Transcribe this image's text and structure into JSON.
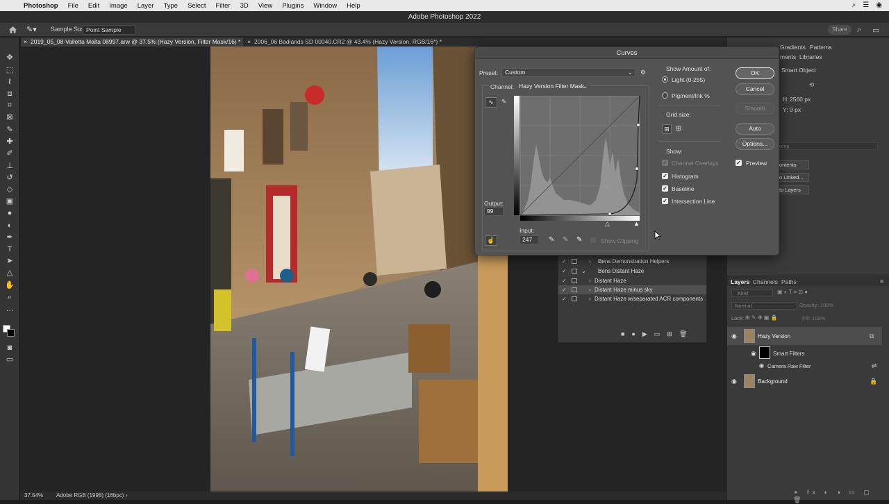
{
  "menubar": {
    "app": "Photoshop",
    "items": [
      "File",
      "Edit",
      "Image",
      "Layer",
      "Type",
      "Select",
      "Filter",
      "3D",
      "View",
      "Plugins",
      "Window",
      "Help"
    ]
  },
  "window_title": "Adobe Photoshop 2022",
  "options": {
    "sample_size_label": "Sample Size:",
    "sample_size_value": "Point Sample",
    "share_label": "Share"
  },
  "doc_tabs": [
    {
      "label": "2019_05_08-Valletta Malta 08997.arw @ 37.5% (Hazy Version, Filter Mask/16) *"
    },
    {
      "label": "2006_06 Badlands SD 00040.CR2 @ 43.4% (Hazy Version, RGB/16*) *"
    }
  ],
  "status": {
    "zoom": "37.54%",
    "profile": "Adobe RGB (1998) (16bpc)"
  },
  "right_panel": {
    "tabs_top": [
      "Gradients",
      "Patterns"
    ],
    "tabs_top2": [
      "ments",
      "Libraries"
    ],
    "smart_object": "Smart Object",
    "h_label": "H:",
    "h_value": "2560 px",
    "y_label": "Y:",
    "y_value": "0 px",
    "comp_placeholder": "omp",
    "buttons": [
      "ontents",
      "o Linked...",
      "to Layers"
    ]
  },
  "actions": {
    "rows": [
      {
        "name": "Bens Demonstration Helpers",
        "indent": 1
      },
      {
        "name": "Bens Distant Haze",
        "indent": 1
      },
      {
        "name": "Distant Haze",
        "indent": 2
      },
      {
        "name": "Distant Haze minus sky",
        "indent": 2,
        "highlight": true
      },
      {
        "name": "Distant Haze w/separated ACR components",
        "indent": 2
      }
    ]
  },
  "layers": {
    "tabs": [
      "Layers",
      "Channels",
      "Paths"
    ],
    "kind_label": "Kind",
    "blend_mode": "Normal",
    "opacity_label": "Opacity:",
    "opacity_value": "100%",
    "lock_label": "Lock:",
    "fill_label": "Fill:",
    "fill_value": "100%",
    "items": [
      {
        "name": "Hazy Version"
      },
      {
        "name": "Smart Filters"
      },
      {
        "name": "Camera Raw Filter"
      },
      {
        "name": "Background"
      }
    ]
  },
  "curves": {
    "title": "Curves",
    "preset_label": "Preset:",
    "preset_value": "Custom",
    "channel_label": "Channel:",
    "channel_value": "Hazy Version Filter Mask",
    "output_label": "Output:",
    "output_value": "99",
    "input_label": "Input:",
    "input_value": "247",
    "show_clipping": "Show Clipping",
    "show_amount_label": "Show Amount of:",
    "light_label": "Light  (0-255)",
    "pigment_label": "Pigment/Ink %",
    "grid_size_label": "Grid size:",
    "show_label": "Show:",
    "show_options": [
      "Channel Overlays",
      "Histogram",
      "Baseline",
      "Intersection Line"
    ],
    "buttons": {
      "ok": "OK",
      "cancel": "Cancel",
      "smooth": "Smooth",
      "auto": "Auto",
      "options": "Options..."
    },
    "preview_label": "Preview"
  }
}
